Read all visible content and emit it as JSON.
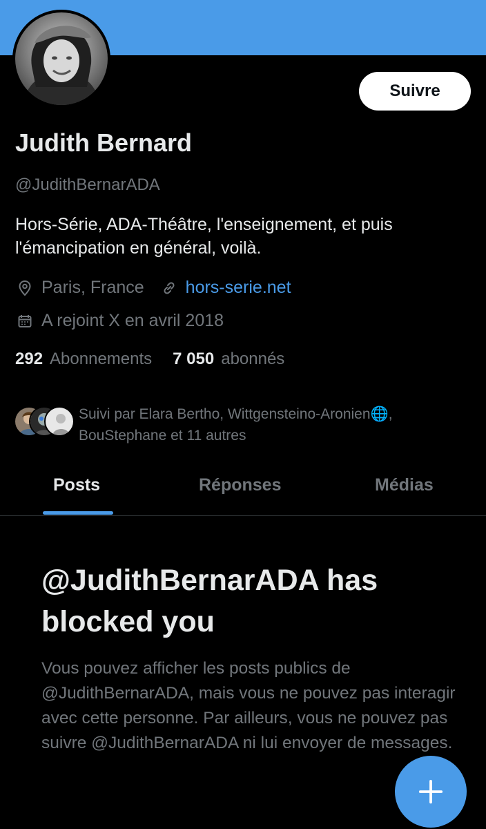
{
  "profile": {
    "follow_label": "Suivre",
    "name": "Judith Bernard",
    "handle": "@JudithBernarADA",
    "bio": "Hors-Série, ADA-Théâtre, l'enseignement, et puis l'émancipation en général, voilà.",
    "location": "Paris, France",
    "website": "hors-serie.net",
    "joined": "A rejoint X en avril 2018"
  },
  "stats": {
    "following_count": "292",
    "following_label": "Abonnements",
    "followers_count": "7 050",
    "followers_label": "abonnés"
  },
  "followed_by": {
    "text": "Suivi par Elara Bertho, Wittgensteino-Aronien🌐, BouStephane et 11 autres"
  },
  "tabs": [
    {
      "label": "Posts",
      "active": true
    },
    {
      "label": "Réponses",
      "active": false
    },
    {
      "label": "Médias",
      "active": false
    }
  ],
  "blocked": {
    "title": "@JudithBernarADA has blocked you",
    "description": "Vous pouvez afficher les posts publics de @JudithBernarADA, mais vous ne pouvez pas interagir avec cette personne. Par ailleurs, vous ne pouvez pas suivre @JudithBernarADA ni lui envoyer de messages."
  },
  "icons": {
    "location": "location-pin-icon",
    "link": "link-icon",
    "calendar": "calendar-icon",
    "compose": "plus-icon"
  },
  "colors": {
    "accent": "#4a9be8",
    "background": "#000000",
    "text_primary": "#e7e9ea",
    "text_secondary": "#71767b"
  }
}
